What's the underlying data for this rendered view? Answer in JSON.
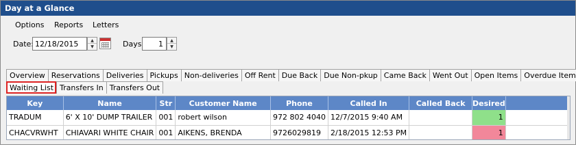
{
  "window": {
    "title": "Day at a Glance"
  },
  "menu": {
    "items": [
      "Options",
      "Reports",
      "Letters"
    ]
  },
  "filters": {
    "date_label": "Date:",
    "date_value": "12/18/2015",
    "days_label": "Days:",
    "days_value": "1"
  },
  "tabs_row1": [
    "Overview",
    "Reservations",
    "Deliveries",
    "Pickups",
    "Non-deliveries",
    "Off Rent",
    "Due Back",
    "Due Non-pkup",
    "Came Back",
    "Went Out",
    "Open Items",
    "Overdue Items"
  ],
  "tabs_row2": [
    "Waiting List",
    "Transfers In",
    "Transfers Out"
  ],
  "active_tab": "Waiting List",
  "table": {
    "columns": [
      "Key",
      "Name",
      "Str",
      "Customer Name",
      "Phone",
      "Called In",
      "Called Back",
      "Desired"
    ],
    "rows": [
      {
        "key": "TRADUM",
        "name": "6' X 10' DUMP TRAILER",
        "str": "001",
        "customer": "robert wilson",
        "phone": "972 802 4040",
        "called_in": "12/7/2015 9:40 AM",
        "called_back": "",
        "desired": "1",
        "desired_color": "#8fe08a"
      },
      {
        "key": "CHACVRWHT",
        "name": "CHIAVARI WHITE CHAIR",
        "str": "001",
        "customer": "AIKENS, BRENDA",
        "phone": "9726029819",
        "called_in": "2/18/2015 12:53 PM",
        "called_back": "",
        "desired": "1",
        "desired_color": "#f2879a"
      }
    ]
  },
  "colors": {
    "title_bar": "#1f4e8c",
    "grid_header": "#5d87c7",
    "active_tab_outline": "#dd2222"
  }
}
